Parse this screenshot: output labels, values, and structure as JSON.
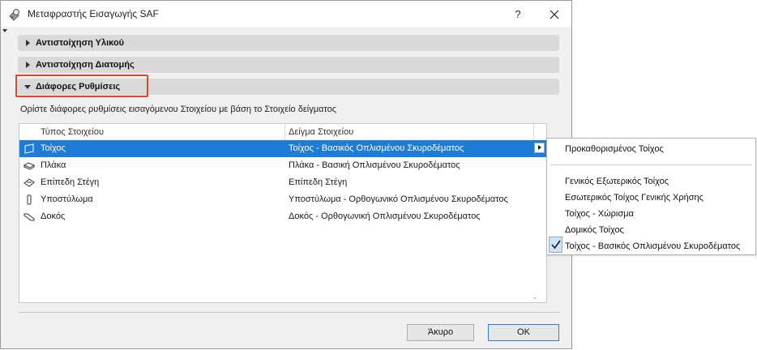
{
  "window": {
    "title": "Μεταφραστής Εισαγωγής SAF",
    "help_label": "?"
  },
  "sections": [
    {
      "label": "Αντιστοίχηση Υλικού",
      "expanded": false
    },
    {
      "label": "Αντιστοίχηση Διατομής",
      "expanded": false
    },
    {
      "label": "Διάφορες Ρυθμίσεις",
      "expanded": true
    }
  ],
  "description": "Ορίστε διάφορες ρυθμίσεις εισαγόμενου Στοιχείου με βάση το Στοιχείο δείγματος",
  "table": {
    "headers": [
      "Τύπος Στοιχείου",
      "Δείγμα Στοιχείου"
    ],
    "rows": [
      {
        "icon": "wall-icon",
        "type": "Τοίχος",
        "sample": "Τοίχος - Βασικός Οπλισμένου Σκυροδέματος",
        "selected": true
      },
      {
        "icon": "slab-icon",
        "type": "Πλάκα",
        "sample": "Πλάκα - Βασική Οπλισμένου Σκυροδέματος",
        "selected": false
      },
      {
        "icon": "roof-icon",
        "type": "Επίπεδη Στέγη",
        "sample": "Επίπεδη Στέγη",
        "selected": false
      },
      {
        "icon": "column-icon",
        "type": "Υποστύλωμα",
        "sample": "Υποστύλωμα - Ορθογωνικό Οπλισμένου Σκυροδέματος",
        "selected": false
      },
      {
        "icon": "beam-icon",
        "type": "Δοκός",
        "sample": "Δοκός - Ορθογωνική Οπλισμένου Σκυροδέματος",
        "selected": false
      }
    ]
  },
  "buttons": {
    "cancel": "Άκυρο",
    "ok": "ΟΚ"
  },
  "popup": {
    "default_item": "Προκαθορισμένος Τοίχος",
    "items": [
      "Γενικός Εξωτερικός Τοίχος",
      "Εσωτερικός Τοίχος Γενικής Χρήσης",
      "Τοίχος - Χώρισμα",
      "Δομικός Τοίχος",
      "Τοίχος - Βασικός Οπλισμένου Σκυροδέματος"
    ],
    "checked_item": "Τοίχος - Βασικός Οπλισμένου Σκυροδέματος"
  },
  "colors": {
    "selection": "#1e7bd6",
    "highlight_frame": "#e8412c",
    "section_bg": "#d9d9d9"
  }
}
